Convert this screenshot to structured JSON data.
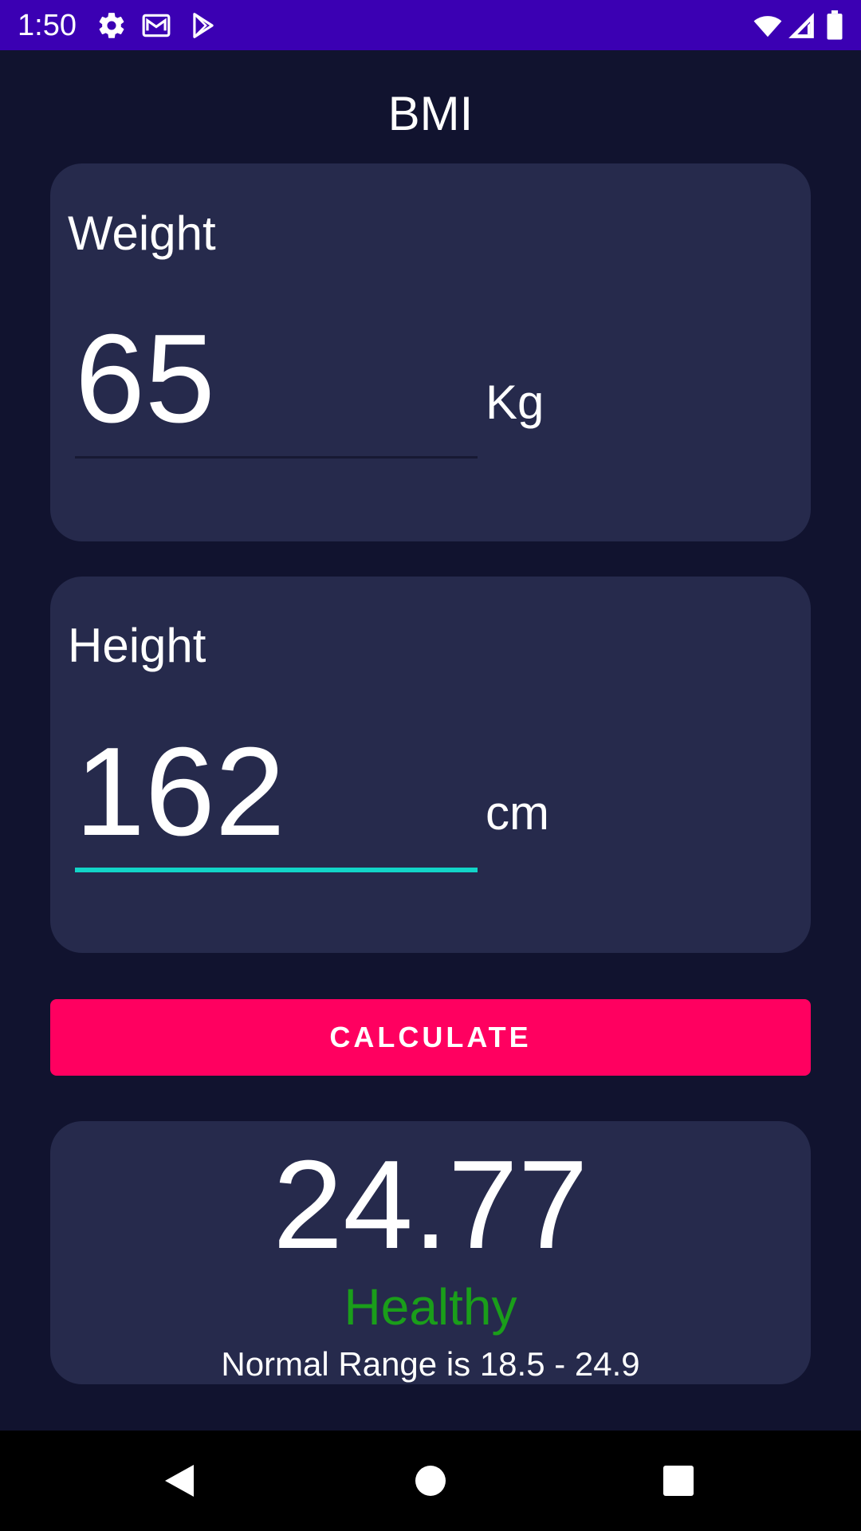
{
  "status_bar": {
    "time": "1:50",
    "icons": [
      "settings-gear-icon",
      "gmail-icon",
      "play-store-icon"
    ],
    "right_icons": [
      "wifi-icon",
      "cell-signal-icon",
      "battery-icon"
    ],
    "background": "#3b00b3"
  },
  "title": "BMI",
  "weight": {
    "label": "Weight",
    "value": "65",
    "unit": "Kg"
  },
  "height": {
    "label": "Height",
    "value": "162",
    "unit": "cm"
  },
  "calculate_button": {
    "label": "CALCULATE",
    "color": "#ff0060"
  },
  "result": {
    "bmi": "24.77",
    "status": "Healthy",
    "status_color": "#1a9e1a",
    "range_text": "Normal Range is 18.5 - 24.9"
  },
  "nav_bar": {
    "buttons": [
      "back-icon",
      "home-icon",
      "recents-icon"
    ]
  },
  "colors": {
    "background": "#11132f",
    "card": "#262a4c",
    "accent_underline": "#12d5c8"
  }
}
